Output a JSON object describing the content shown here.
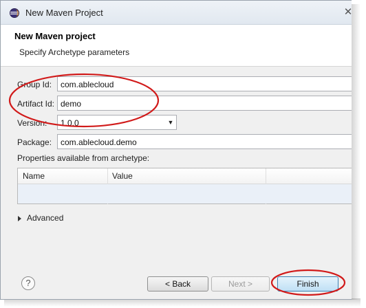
{
  "window": {
    "title": "New Maven Project",
    "close_glyph": "✕"
  },
  "header": {
    "title": "New Maven project",
    "subtitle": "Specify Archetype parameters"
  },
  "fields": {
    "group_id": {
      "label": "Group Id:",
      "value": "com.ablecloud"
    },
    "artifact_id": {
      "label": "Artifact Id:",
      "value": "demo"
    },
    "version": {
      "label": "Version:",
      "value": "1.0.0"
    },
    "package": {
      "label": "Package:",
      "value": "com.ablecloud.demo"
    }
  },
  "properties": {
    "label": "Properties available from archetype:",
    "columns": [
      "Name",
      "Value"
    ],
    "rows": []
  },
  "advanced": {
    "label": "Advanced"
  },
  "buttons": {
    "help": "?",
    "back": "< Back",
    "next": "Next >",
    "finish": "Finish"
  },
  "annotations": {
    "color": "#d11a1a"
  }
}
